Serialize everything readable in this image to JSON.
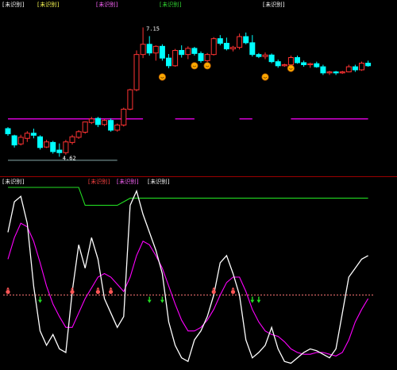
{
  "top_panel": {
    "title": "[未识别]",
    "header_items": [
      {
        "text": "[未识别]",
        "color": "#ffff55"
      },
      {
        "text": "[未识别]",
        "color": "#ff66ff"
      },
      {
        "text": "[未识别]",
        "color": "#33dd33"
      },
      {
        "text": "[未识别]",
        "color": "#ffffff"
      }
    ],
    "high_label": "7.15",
    "low_label": "4.62",
    "price_range": [
      4.3,
      7.5
    ]
  },
  "bottom_panel": {
    "title": "[未识别]",
    "header_items": [
      {
        "text": "[未识别]",
        "color": "#ff4444"
      },
      {
        "text": "[未识别]",
        "color": "#ff66ff"
      },
      {
        "text": "[未识别]",
        "color": "#ffffff"
      }
    ],
    "value_range": [
      0,
      100
    ]
  },
  "colors": {
    "up": "#ff3333",
    "down": "#00ffff",
    "magenta": "#ff00ff",
    "green": "#22dd22",
    "white": "#ffffff",
    "coin": "#ffaa00",
    "separator": "#990000"
  },
  "chart_data": [
    {
      "type": "candlestick",
      "series": [
        {
          "name": "price",
          "ohlc": [
            [
              5.17,
              5.2,
              5.03,
              5.07
            ],
            [
              5.03,
              5.05,
              4.8,
              4.85
            ],
            [
              4.87,
              5.05,
              4.84,
              5.0
            ],
            [
              4.98,
              5.12,
              4.91,
              5.08
            ],
            [
              5.08,
              5.17,
              4.98,
              5.04
            ],
            [
              5.01,
              5.04,
              4.76,
              4.8
            ],
            [
              4.81,
              4.95,
              4.79,
              4.91
            ],
            [
              4.9,
              4.93,
              4.68,
              4.72
            ],
            [
              4.75,
              4.88,
              4.62,
              4.7
            ],
            [
              4.7,
              4.95,
              4.66,
              4.91
            ],
            [
              4.9,
              5.05,
              4.86,
              5.01
            ],
            [
              5.0,
              5.14,
              4.97,
              5.11
            ],
            [
              5.1,
              5.31,
              5.07,
              5.3
            ],
            [
              5.29,
              5.4,
              5.26,
              5.36
            ],
            [
              5.37,
              5.4,
              5.2,
              5.25
            ],
            [
              5.25,
              5.36,
              5.22,
              5.33
            ],
            [
              5.33,
              5.37,
              5.11,
              5.14
            ],
            [
              5.14,
              5.27,
              5.11,
              5.24
            ],
            [
              5.24,
              5.58,
              5.21,
              5.55
            ],
            [
              5.55,
              5.95,
              5.53,
              5.93
            ],
            [
              5.93,
              6.7,
              5.9,
              6.62
            ],
            [
              6.62,
              7.15,
              6.55,
              6.82
            ],
            [
              6.82,
              6.98,
              6.6,
              6.65
            ],
            [
              6.65,
              6.8,
              6.5,
              6.78
            ],
            [
              6.78,
              6.82,
              6.5,
              6.55
            ],
            [
              6.55,
              6.63,
              6.35,
              6.4
            ],
            [
              6.4,
              6.73,
              6.38,
              6.7
            ],
            [
              6.7,
              6.8,
              6.56,
              6.62
            ],
            [
              6.62,
              6.78,
              6.53,
              6.74
            ],
            [
              6.74,
              6.77,
              6.6,
              6.64
            ],
            [
              6.64,
              6.68,
              6.46,
              6.5
            ],
            [
              6.5,
              6.65,
              6.47,
              6.62
            ],
            [
              6.62,
              6.96,
              6.6,
              6.93
            ],
            [
              6.93,
              7.0,
              6.8,
              6.84
            ],
            [
              6.84,
              6.95,
              6.7,
              6.73
            ],
            [
              6.73,
              6.79,
              6.68,
              6.76
            ],
            [
              6.76,
              7.03,
              6.72,
              6.97
            ],
            [
              6.97,
              7.05,
              6.82,
              6.85
            ],
            [
              6.85,
              7.0,
              6.58,
              6.62
            ],
            [
              6.62,
              6.65,
              6.55,
              6.58
            ],
            [
              6.58,
              6.66,
              6.53,
              6.61
            ],
            [
              6.61,
              6.64,
              6.45,
              6.48
            ],
            [
              6.48,
              6.52,
              6.36,
              6.4
            ],
            [
              6.4,
              6.44,
              6.38,
              6.42
            ],
            [
              6.42,
              6.6,
              6.4,
              6.56
            ],
            [
              6.56,
              6.6,
              6.44,
              6.46
            ],
            [
              6.46,
              6.5,
              6.38,
              6.42
            ],
            [
              6.42,
              6.46,
              6.36,
              6.44
            ],
            [
              6.44,
              6.48,
              6.36,
              6.38
            ],
            [
              6.38,
              6.42,
              6.22,
              6.26
            ],
            [
              6.26,
              6.3,
              6.22,
              6.28
            ],
            [
              6.28,
              6.3,
              6.22,
              6.26
            ],
            [
              6.26,
              6.3,
              6.24,
              6.28
            ],
            [
              6.28,
              6.42,
              6.27,
              6.38
            ],
            [
              6.38,
              6.42,
              6.28,
              6.32
            ],
            [
              6.32,
              6.48,
              6.3,
              6.45
            ],
            [
              6.45,
              6.5,
              6.38,
              6.4
            ]
          ]
        }
      ],
      "resistance_segments": [
        {
          "value": 5.36,
          "from": 0,
          "to": 21
        },
        {
          "value": 5.36,
          "from": 26,
          "to": 29
        },
        {
          "value": 5.36,
          "from": 36,
          "to": 38
        },
        {
          "value": 5.36,
          "from": 44,
          "to": 56
        }
      ],
      "support_segment": {
        "value": 4.55,
        "from": 0,
        "to": 17
      },
      "coin_markers": [
        {
          "index": 24,
          "value": 6.18
        },
        {
          "index": 29,
          "value": 6.4
        },
        {
          "index": 31,
          "value": 6.4
        },
        {
          "index": 40,
          "value": 6.18
        },
        {
          "index": 44,
          "value": 6.35
        }
      ]
    },
    {
      "type": "line",
      "x_count": 57,
      "ylim": [
        0,
        100
      ],
      "reference_line": 40,
      "series": [
        {
          "color": "#ffffff",
          "values": [
            75,
            92,
            95,
            80,
            45,
            20,
            12,
            18,
            10,
            8,
            42,
            68,
            55,
            72,
            60,
            38,
            30,
            22,
            28,
            90,
            98,
            85,
            75,
            65,
            52,
            25,
            12,
            5,
            3,
            15,
            20,
            28,
            40,
            58,
            62,
            52,
            40,
            15,
            5,
            8,
            12,
            22,
            10,
            3,
            2,
            5,
            8,
            10,
            9,
            7,
            5,
            10,
            30,
            50,
            55,
            60,
            62
          ]
        },
        {
          "color": "#ff00ff",
          "values": [
            60,
            72,
            80,
            78,
            70,
            58,
            45,
            35,
            28,
            22,
            22,
            30,
            38,
            44,
            50,
            52,
            50,
            46,
            42,
            50,
            62,
            70,
            68,
            62,
            55,
            45,
            35,
            26,
            20,
            20,
            22,
            26,
            32,
            40,
            47,
            50,
            50,
            42,
            32,
            25,
            20,
            18,
            17,
            14,
            10,
            8,
            7,
            7,
            8,
            8,
            7,
            6,
            8,
            15,
            25,
            32,
            38
          ]
        },
        {
          "color": "#22dd22",
          "values": [
            100,
            100,
            100,
            100,
            100,
            100,
            100,
            100,
            100,
            100,
            100,
            100,
            90,
            90,
            90,
            90,
            90,
            90,
            92,
            94,
            94,
            94,
            94,
            94,
            94,
            94,
            94,
            94,
            94,
            94,
            94,
            94,
            94,
            94,
            94,
            94,
            94,
            94,
            94,
            94,
            94,
            94,
            94,
            94,
            94,
            94,
            94,
            94,
            94,
            94,
            94,
            94,
            94,
            94,
            94,
            94,
            94
          ]
        }
      ],
      "up_markers": [
        0,
        10,
        14,
        16,
        32,
        35
      ],
      "down_markers": [
        5,
        22,
        24,
        38,
        39
      ]
    }
  ]
}
